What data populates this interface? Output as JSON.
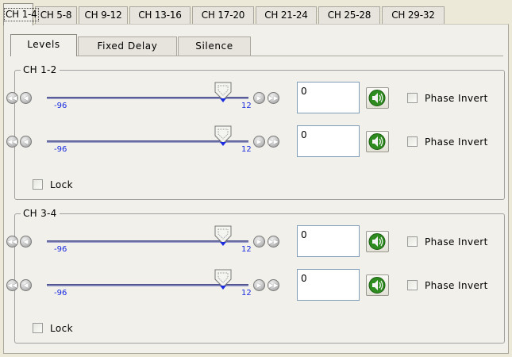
{
  "top_tabs": [
    "CH 1-4",
    "CH 5-8",
    "CH 9-12",
    "CH 13-16",
    "CH 17-20",
    "CH 21-24",
    "CH 25-28",
    "CH 29-32"
  ],
  "top_tab_active": 0,
  "inner_tabs": [
    "Levels",
    "Fixed Delay",
    "Silence"
  ],
  "inner_tab_active": 0,
  "groups": [
    {
      "title": "CH 1-2",
      "rows": [
        {
          "slider_min": "-96",
          "slider_max": "12",
          "slider_value": 0,
          "level_value": "0",
          "phase_invert_label": "Phase Invert",
          "phase_invert_checked": false
        },
        {
          "slider_min": "-96",
          "slider_max": "12",
          "slider_value": 0,
          "level_value": "0",
          "phase_invert_label": "Phase Invert",
          "phase_invert_checked": false
        }
      ],
      "lock_label": "Lock",
      "lock_checked": false
    },
    {
      "title": "CH 3-4",
      "rows": [
        {
          "slider_min": "-96",
          "slider_max": "12",
          "slider_value": 0,
          "level_value": "0",
          "phase_invert_label": "Phase Invert",
          "phase_invert_checked": false
        },
        {
          "slider_min": "-96",
          "slider_max": "12",
          "slider_value": 0,
          "level_value": "0",
          "phase_invert_label": "Phase Invert",
          "phase_invert_checked": false
        }
      ],
      "lock_label": "Lock",
      "lock_checked": false
    }
  ],
  "icons": {
    "fast_back": "double-left-arrow-icon",
    "back": "left-arrow-icon",
    "forward": "right-arrow-icon",
    "fast_forward": "double-right-arrow-icon",
    "speaker": "speaker-icon"
  },
  "colors": {
    "background": "#ece9d8",
    "panel": "#f1f0ea",
    "slider_track": "#6d71a8",
    "tick_label": "#1a2be0",
    "speaker_green": "#2e8b1f"
  }
}
